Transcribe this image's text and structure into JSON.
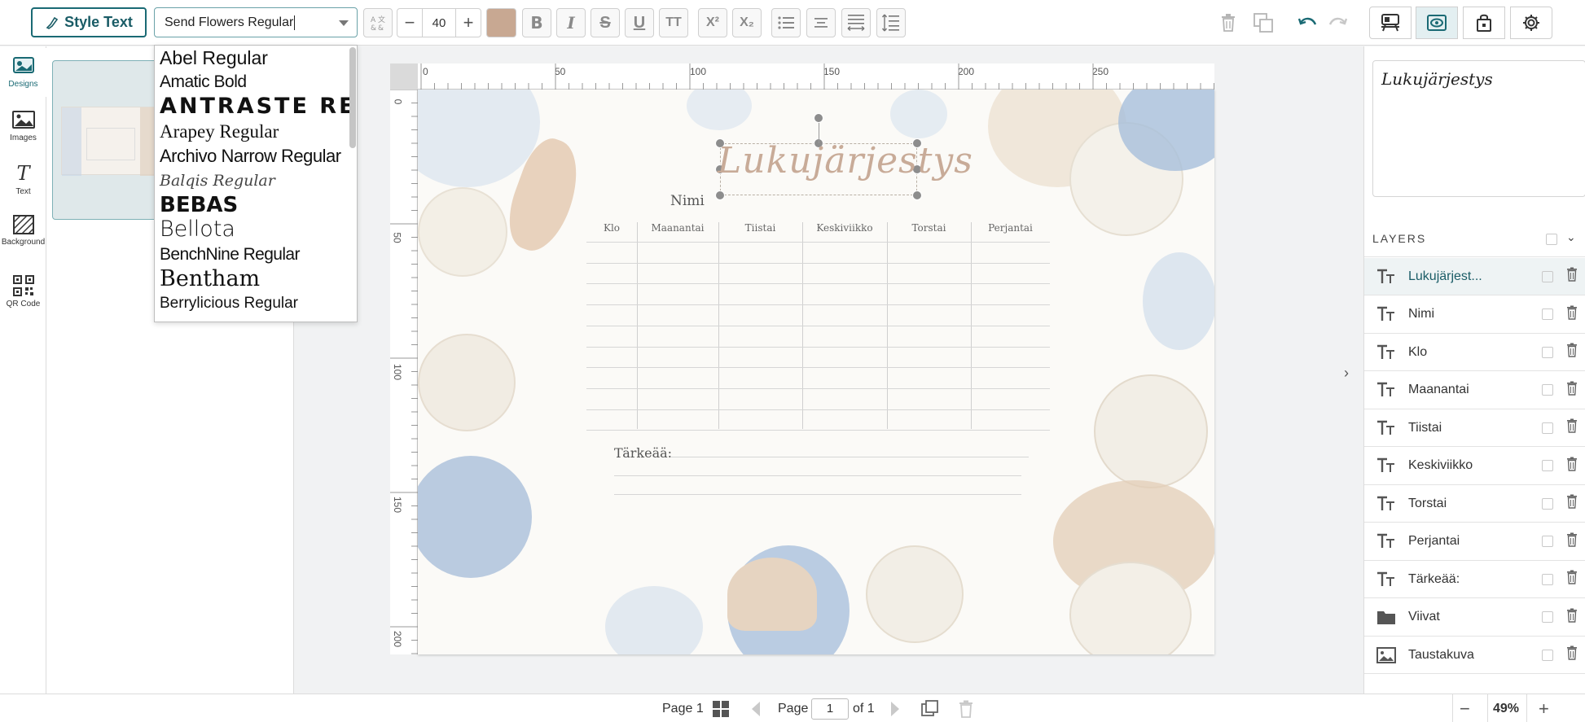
{
  "toolbar": {
    "style_text_label": "Style Text",
    "font_value": "Send Flowers Regular",
    "font_size": "40",
    "minus": "−",
    "plus": "+",
    "text_color": "#c8a892",
    "bold": "B",
    "italic": "I",
    "strike": "S",
    "underline": "U",
    "caps": "TT",
    "superscript": "X²",
    "subscript": "X₂"
  },
  "font_options": [
    "Abel Regular",
    "Amatic Bold",
    "ANTRASTE REG",
    "Arapey Regular",
    "Archivo Narrow Regular",
    "Balqis Regular",
    "BEBAS",
    "Bellota",
    "BenchNine Regular",
    "Bentham",
    "Berrylicious Regular"
  ],
  "rail": {
    "designs": "Designs",
    "images": "Images",
    "text": "Text",
    "background": "Background",
    "qr": "QR Code"
  },
  "ruler": {
    "top": [
      "0",
      "50",
      "100",
      "150",
      "200",
      "250"
    ],
    "left": [
      "0",
      "50",
      "100",
      "150",
      "200"
    ]
  },
  "design": {
    "title": "Lukujärjestys",
    "name_label": "Nimi",
    "columns": [
      "Klo",
      "Maanantai",
      "Tiistai",
      "Keskiviikko",
      "Torstai",
      "Perjantai"
    ],
    "important_label": "Tärkeää:"
  },
  "right": {
    "preview_text": "Lukujärjestys",
    "layers_heading": "LAYERS",
    "layers": [
      {
        "name": "Lukujärjest...",
        "icon": "text-icon"
      },
      {
        "name": "Nimi",
        "icon": "text-icon"
      },
      {
        "name": "Klo",
        "icon": "text-icon"
      },
      {
        "name": "Maanantai",
        "icon": "text-icon"
      },
      {
        "name": "Tiistai",
        "icon": "text-icon"
      },
      {
        "name": "Keskiviikko",
        "icon": "text-icon"
      },
      {
        "name": "Torstai",
        "icon": "text-icon"
      },
      {
        "name": "Perjantai",
        "icon": "text-icon"
      },
      {
        "name": "Tärkeää:",
        "icon": "text-icon"
      },
      {
        "name": "Viivat",
        "icon": "folder-icon"
      },
      {
        "name": "Taustakuva",
        "icon": "image-icon"
      }
    ]
  },
  "bottom": {
    "page_label": "Page 1",
    "page_word": "Page",
    "page_number": "1",
    "of_label": "of 1",
    "zoom": "49%",
    "zoom_minus": "−",
    "zoom_plus": "+"
  },
  "colors": {
    "accent": "#1a6a74",
    "title_color": "#c8ab98",
    "flower_blue": "#9fb8d4",
    "shell_beige": "#d9c2ab"
  }
}
